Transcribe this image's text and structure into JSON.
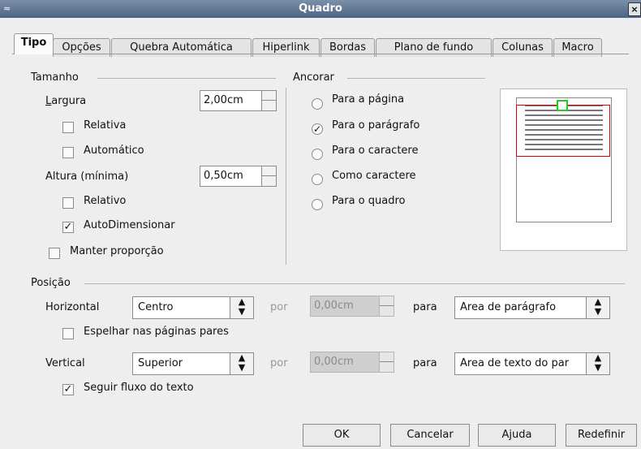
{
  "window": {
    "title": "Quadro",
    "close_icon": "×"
  },
  "tabs": [
    {
      "label": "Tipo",
      "active": true
    },
    {
      "label": "Opções"
    },
    {
      "label": "Quebra Automática"
    },
    {
      "label": "Hiperlink"
    },
    {
      "label": "Bordas"
    },
    {
      "label": "Plano de fundo"
    },
    {
      "label": "Colunas"
    },
    {
      "label": "Macro"
    }
  ],
  "size": {
    "group_label": "Tamanho",
    "width_label": "Largura",
    "width_value": "2,00cm",
    "relative_w_label": "Relativa",
    "automatic_label": "Automático",
    "height_label": "Altura (mínima)",
    "height_value": "0,50cm",
    "relative_h_label": "Relativo",
    "autosize_label": "AutoDimensionar",
    "autosize_checked": true,
    "keep_ratio_label": "Manter proporção"
  },
  "anchor": {
    "group_label": "Ancorar",
    "options": [
      "Para a página",
      "Para o parágrafo",
      "Para o caractere",
      "Como caractere",
      "Para o quadro"
    ],
    "selected": "Para o parágrafo"
  },
  "position": {
    "group_label": "Posição",
    "horizontal_label": "Horizontal",
    "horizontal_value": "Centro",
    "by_label": "por",
    "h_by_value": "0,00cm",
    "to_label": "para",
    "h_to_value": "Área de parágrafo",
    "mirror_label": "Espelhar nas páginas pares",
    "vertical_label": "Vertical",
    "vertical_value": "Superior",
    "v_by_value": "0,00cm",
    "v_to_value": "Área de texto do par",
    "follow_flow_label": "Seguir fluxo do texto",
    "follow_flow_checked": true
  },
  "buttons": {
    "ok": "OK",
    "cancel": "Cancelar",
    "help": "Ajuda",
    "reset": "Redefinir"
  },
  "colors": {
    "titlebar": "#5a6f8e",
    "preview_frame": "#e00000",
    "preview_anchor": "#22cc22"
  }
}
